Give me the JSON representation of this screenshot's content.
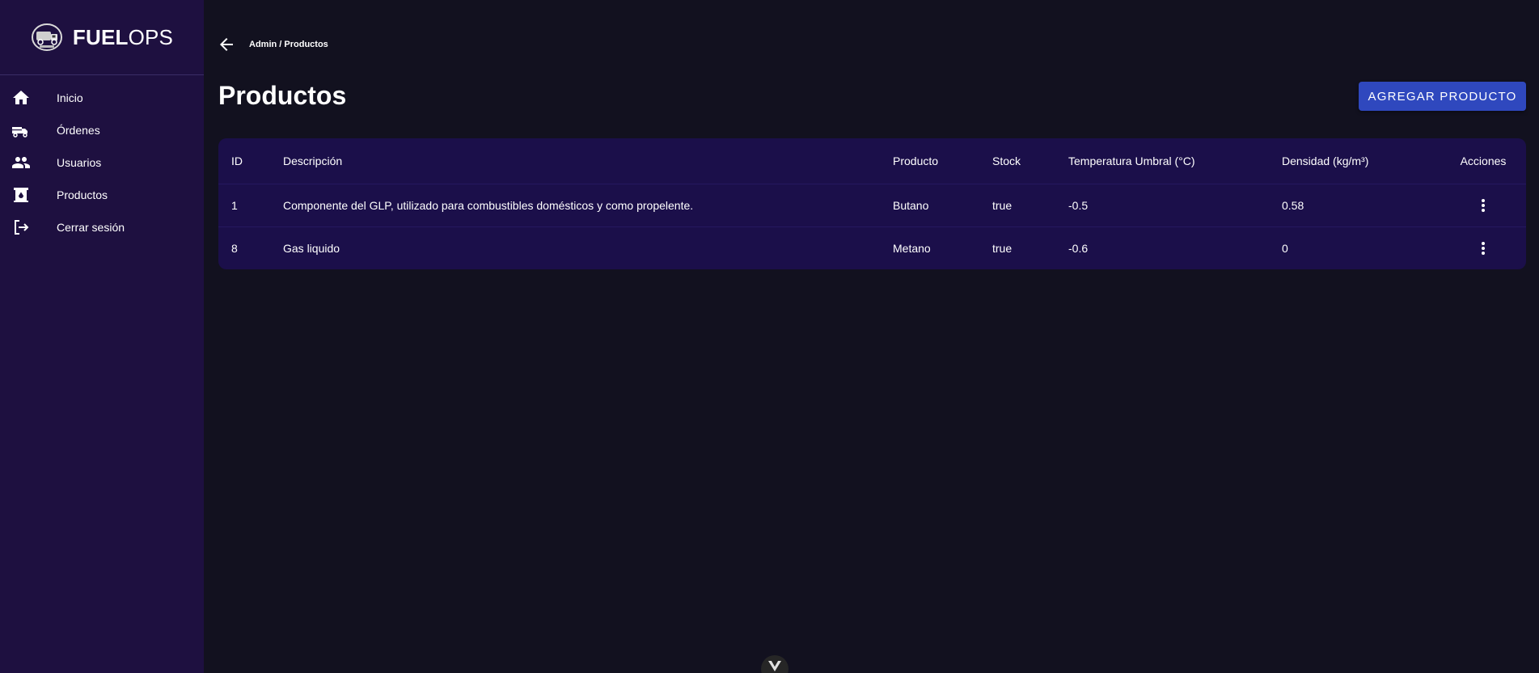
{
  "app": {
    "brand_bold": "FUEL",
    "brand_light": "OPS",
    "accent_color": "#2f48be",
    "sidebar_color": "#1e1040",
    "background_color": "#12111f",
    "table_color": "#1b0f4a"
  },
  "sidebar": {
    "items": [
      {
        "label": "Inicio",
        "icon": "home-icon"
      },
      {
        "label": "Órdenes",
        "icon": "delivery-truck-icon"
      },
      {
        "label": "Usuarios",
        "icon": "people-icon"
      },
      {
        "label": "Productos",
        "icon": "gas-station-icon"
      },
      {
        "label": "Cerrar sesión",
        "icon": "logout-icon"
      }
    ]
  },
  "header": {
    "breadcrumb": "Admin / Productos",
    "back_icon": "arrow-left-icon"
  },
  "main": {
    "title": "Productos",
    "add_button_label": "AGREGAR PRODUCTO"
  },
  "table": {
    "columns": [
      "ID",
      "Descripción",
      "Producto",
      "Stock",
      "Temperatura Umbral (°C)",
      "Densidad (kg/m³)",
      "Acciones"
    ],
    "rows": [
      {
        "id": "1",
        "descripcion": "Componente del GLP, utilizado para combustibles domésticos y como propelente.",
        "producto": "Butano",
        "stock": "true",
        "temperatura": "-0.5",
        "densidad": "0.58",
        "action_icon": "more-vertical-icon"
      },
      {
        "id": "8",
        "descripcion": "Gas liquido",
        "producto": "Metano",
        "stock": "true",
        "temperatura": "-0.6",
        "densidad": "0",
        "action_icon": "more-vertical-icon"
      }
    ]
  }
}
